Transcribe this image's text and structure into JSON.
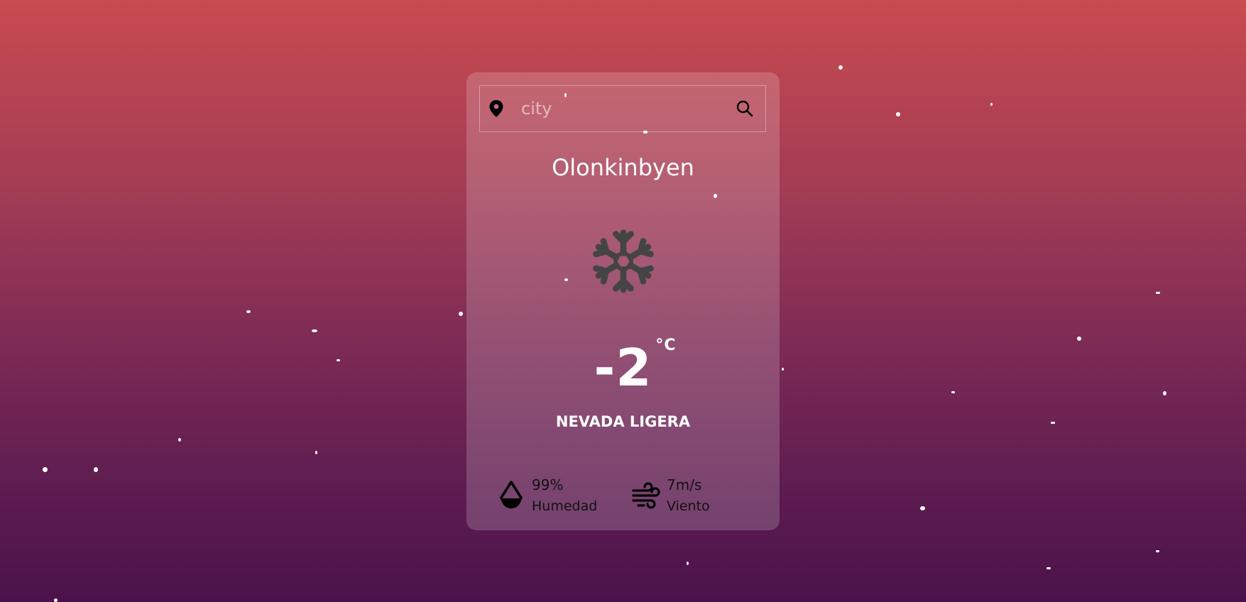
{
  "search": {
    "placeholder": "city",
    "value": ""
  },
  "weather": {
    "city": "Olonkinbyen",
    "icon": "snowflake-icon",
    "temperature": "-2",
    "unit": "°C",
    "description": "NEVADA LIGERA"
  },
  "stats": {
    "humidity": {
      "value": "99%",
      "label": "Humedad",
      "icon": "water-drop-icon"
    },
    "wind": {
      "value": "7m/s",
      "label": "Viento",
      "icon": "wind-icon"
    }
  },
  "colors": {
    "background_top": "#c84b4f",
    "background_bottom": "#4a124b",
    "card": "rgba(255,255,255,0.18)",
    "icon_gray": "#444444",
    "text_white": "#ffffff",
    "text_dark": "#111111"
  }
}
